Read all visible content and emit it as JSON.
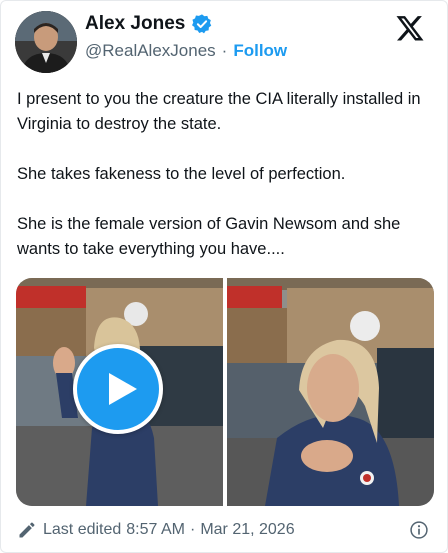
{
  "author": {
    "name": "Alex Jones",
    "handle": "@RealAlexJones",
    "separator": "·",
    "follow_label": "Follow",
    "verified_icon": "verified-badge-icon",
    "avatar_icon": "avatar"
  },
  "platform_icon": "x-logo-icon",
  "post": {
    "paragraphs": [
      "I present to you the creature the CIA literally installed in Virginia to destroy the state.",
      "She takes fakeness to the level of perfection.",
      "She is the female version of Gavin Newsom and she wants to take everything you have...."
    ]
  },
  "media": {
    "play_icon": "play-icon",
    "frames": [
      "video-frame-left",
      "video-frame-right"
    ]
  },
  "footer": {
    "edited_label": "Last edited",
    "time": "8:57 AM",
    "separator": "·",
    "date": "Mar 21, 2026",
    "edit_icon": "pencil-icon",
    "info_icon": "info-icon"
  },
  "colors": {
    "accent": "#1d9bf0",
    "text": "#0f1419",
    "muted": "#536471"
  }
}
